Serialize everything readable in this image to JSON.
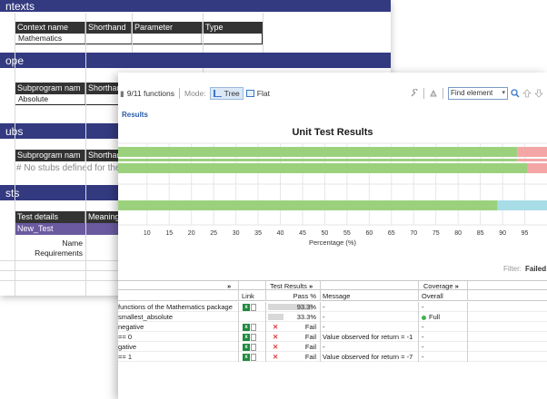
{
  "sheet": {
    "sections": {
      "contexts": "ntexts",
      "scope": "ope",
      "stubs": "ubs",
      "tests": "sts"
    },
    "contexts_table": {
      "headers": [
        "Context name",
        "Shorthand",
        "Parameter",
        "Type"
      ],
      "row": [
        "Mathematics",
        "",
        "",
        ""
      ]
    },
    "scope_table": {
      "headers": [
        "Subprogram nam",
        "Shorthan"
      ],
      "row": [
        "Absolute",
        ""
      ]
    },
    "stubs_table": {
      "headers": [
        "Subprogram nam",
        "Shorthan"
      ],
      "note": "# No stubs defined for the"
    },
    "tests_table": {
      "headers": [
        "Test details",
        "Meaning"
      ],
      "test_name": "New_Test",
      "fields": [
        "Name",
        "Requirements"
      ]
    }
  },
  "toolbar": {
    "function_count": "9/11 functions",
    "mode_label": "Mode:",
    "tree_label": "Tree",
    "flat_label": "Flat",
    "find_value": "Find element"
  },
  "results_label": "Results",
  "filter": {
    "label": "Filter:",
    "value": "Failed"
  },
  "chart_data": {
    "type": "bar",
    "title": "Unit Test Results",
    "xlabel": "Percentage (%)",
    "ylabel": "",
    "xticks": [
      10,
      15,
      20,
      25,
      30,
      35,
      40,
      45,
      50,
      55,
      60,
      65,
      70,
      75,
      80,
      85,
      90,
      95
    ],
    "xlim": [
      3.5,
      100
    ],
    "bars": [
      {
        "pass": 93.3,
        "other": 6.7,
        "other_color": "#f4a6a6"
      },
      {
        "pass": 93.3,
        "other": 6.7,
        "other_color": "#f4a6a6"
      },
      {
        "pass": 95.5,
        "other": 4.5,
        "other_color": "#f4a6a6"
      },
      {
        "pass": 88.9,
        "other": 11.1,
        "other_color": "#a8dde8"
      }
    ],
    "colors": {
      "pass": "#9bd17d",
      "fail": "#f4a6a6",
      "coverage": "#a8dde8"
    }
  },
  "table": {
    "group_headers": {
      "test_results": "Test Results",
      "coverage": "Coverage"
    },
    "headers": {
      "link": "Link",
      "pass": "Pass %",
      "message": "Message",
      "overall": "Overall"
    },
    "rows": [
      {
        "name": "functions of the Mathematics package",
        "link": true,
        "pass": "93.3%",
        "pass_fraction": 0.933,
        "fail": false,
        "message": "-",
        "overall": "-",
        "overall_ok": false
      },
      {
        "name": "smallest_absolute",
        "link": false,
        "pass": "33.3%",
        "pass_fraction": 0.333,
        "fail": false,
        "message": "-",
        "overall": "Full",
        "overall_ok": true
      },
      {
        "name": "negative",
        "link": true,
        "pass": "Fail",
        "fail": true,
        "message": "-",
        "overall": "-",
        "overall_ok": false
      },
      {
        "name": "== 0",
        "link": true,
        "pass": "Fail",
        "fail": true,
        "message": "Value observed for return = -1",
        "overall": "-",
        "overall_ok": false
      },
      {
        "name": "gative",
        "link": true,
        "pass": "Fail",
        "fail": true,
        "message": "-",
        "overall": "-",
        "overall_ok": false
      },
      {
        "name": "== 1",
        "link": true,
        "pass": "Fail",
        "fail": true,
        "message": "Value observed for return = -7",
        "overall": "-",
        "overall_ok": false
      }
    ]
  }
}
